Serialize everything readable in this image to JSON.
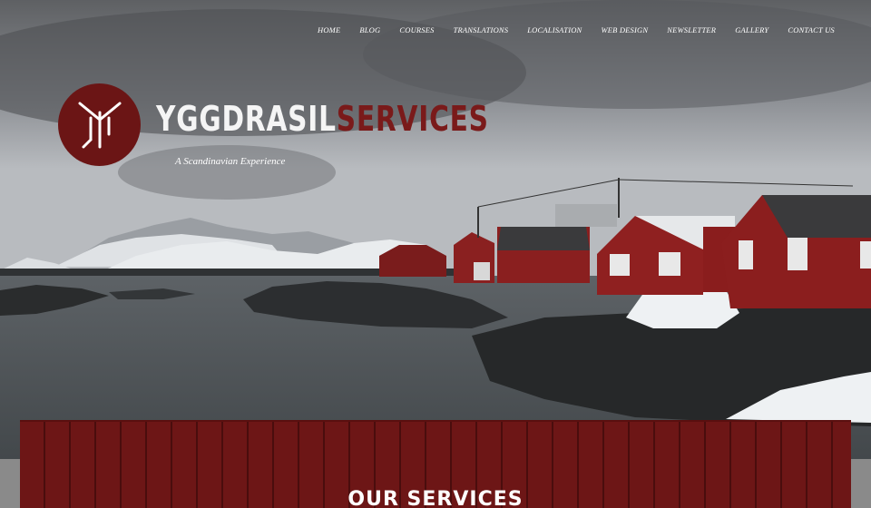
{
  "nav": {
    "items": [
      {
        "label": "HOME"
      },
      {
        "label": "BLOG"
      },
      {
        "label": "COURSES"
      },
      {
        "label": "TRANSLATIONS"
      },
      {
        "label": "LOCALISATION"
      },
      {
        "label": "WEB DESIGN"
      },
      {
        "label": "NEWSLETTER"
      },
      {
        "label": "GALLERY"
      },
      {
        "label": "CONTACT US"
      }
    ]
  },
  "brand": {
    "name_white": "YGGDRASIL",
    "name_red": "SERVICES",
    "tagline": "A Scandinavian Experience"
  },
  "services": {
    "title": "OUR SERVICES"
  },
  "colors": {
    "brand_red": "#6b1515",
    "nav_text": "#ffffff"
  }
}
